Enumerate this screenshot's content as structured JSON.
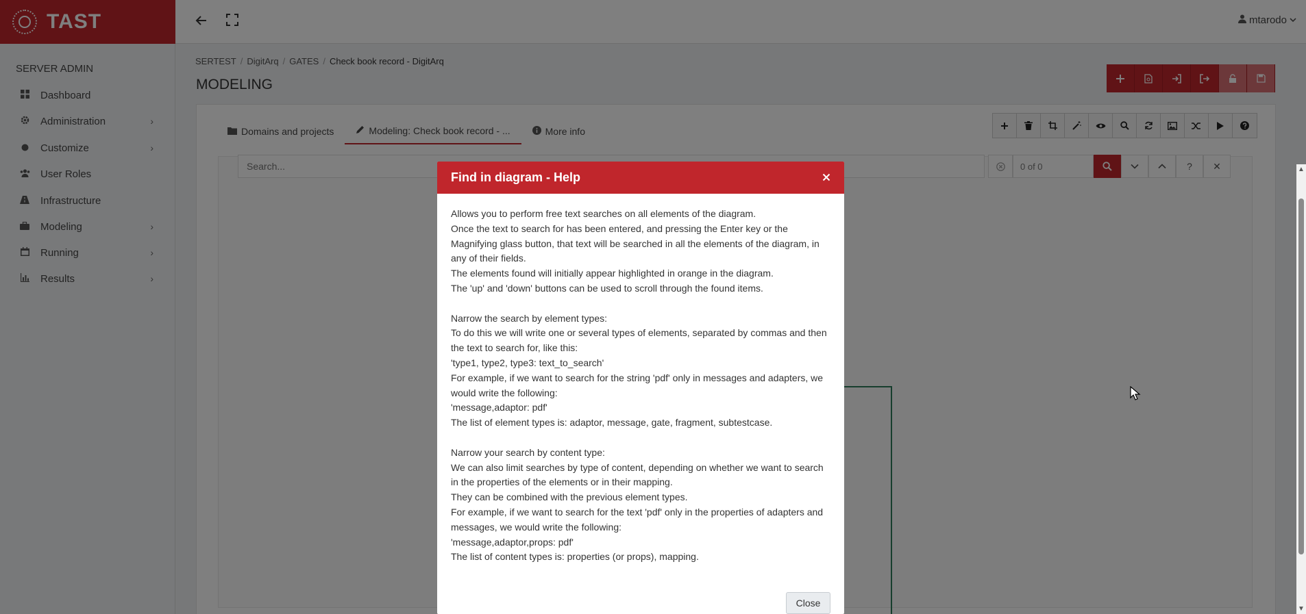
{
  "brand": {
    "name": "TAST"
  },
  "topbar": {
    "user": "mtarodo",
    "user_icon": "user-icon",
    "back_icon": "arrow-left-icon",
    "fullscreen_icon": "expand-icon"
  },
  "sidebar": {
    "section_title": "SERVER ADMIN",
    "items": [
      {
        "label": "Dashboard",
        "icon": "dashboard-icon",
        "has_children": false
      },
      {
        "label": "Administration",
        "icon": "gear-icon",
        "has_children": true
      },
      {
        "label": "Customize",
        "icon": "circle-icon",
        "has_children": true
      },
      {
        "label": "User Roles",
        "icon": "users-icon",
        "has_children": false
      },
      {
        "label": "Infrastructure",
        "icon": "road-icon",
        "has_children": false
      },
      {
        "label": "Modeling",
        "icon": "briefcase-icon",
        "has_children": true
      },
      {
        "label": "Running",
        "icon": "calendar-icon",
        "has_children": true
      },
      {
        "label": "Results",
        "icon": "chart-icon",
        "has_children": true
      }
    ]
  },
  "breadcrumb": [
    "SERTEST",
    "DigitArq",
    "GATES",
    "Check book record - DigitArq"
  ],
  "page_title": "MODELING",
  "tabs": [
    {
      "label": "Domains and projects",
      "icon": "folder-icon",
      "active": false
    },
    {
      "label": "Modeling: Check book record - ...",
      "icon": "pencil-icon",
      "active": true
    },
    {
      "label": "More info",
      "icon": "info-icon",
      "active": false
    }
  ],
  "search": {
    "placeholder": "Search...",
    "count": "0 of 0",
    "help_label": "?",
    "close_label": "✕"
  },
  "modal": {
    "title": "Find in diagram - Help",
    "close_label": "Close",
    "paragraphs": [
      [
        "Allows you to perform free text searches on all elements of the diagram.",
        "Once the text to search for has been entered, and pressing the Enter key or the Magnifying glass button, that text will be searched in all the elements of the diagram, in any of their fields.",
        "The elements found will initially appear highlighted in orange in the diagram.",
        "The 'up' and 'down' buttons can be used to scroll through the found items."
      ],
      [
        "Narrow the search by element types:",
        "To do this we will write one or several types of elements, separated by commas and then the text to search for, like this:",
        "'type1, type2, type3: text_to_search'",
        "For example, if we want to search for the string 'pdf' only in messages and adapters, we would write the following:",
        "'message,adaptor: pdf'",
        "The list of element types is: adaptor, message, gate, fragment, subtestcase."
      ],
      [
        "Narrow your search by content type:",
        "We can also limit searches by type of content, depending on whether we want to search in the properties of the elements or in their mapping.",
        "They can be combined with the previous element types.",
        "For example, if we want to search for the text 'pdf' only in the properties of adapters and messages, we would write the following:",
        "'message,adaptor,props: pdf'",
        "The list of content types is: properties (or props), mapping."
      ]
    ]
  },
  "colors": {
    "accent": "#c0262c",
    "diagram_line": "#2e7d5b"
  }
}
